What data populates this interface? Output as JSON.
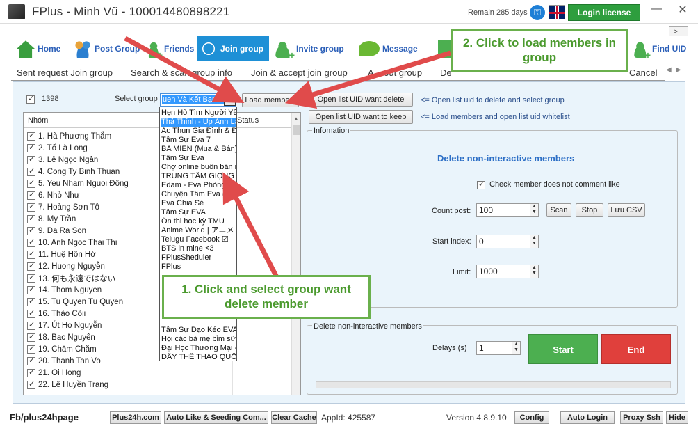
{
  "window": {
    "title": "FPlus - Minh Vũ - 100014480898221",
    "remain": "Remain 285 days",
    "login_label": "Login license",
    "min_symbol": "—",
    "close_symbol": "✕",
    "expand_label": ">..."
  },
  "nav": {
    "home": "Home",
    "post_group": "Post Group",
    "friends": "Friends",
    "join_group": "Join group",
    "invite_group": "Invite group",
    "message": "Message",
    "find_uid": "Find UID"
  },
  "subtabs": {
    "sent_request": "Sent request Join group",
    "search_scan": "Search & scan group info",
    "join_accept": "Join & accept join group",
    "a_out_group": "A... out group",
    "de": "De",
    "cancel": "Cancel",
    "prev_arrow": "◀",
    "next_arrow": "▶"
  },
  "controls": {
    "group_count": "1398",
    "select_label": "Select group",
    "selected_group": "uen Và Kết Bạn 15",
    "load_members": "Load members",
    "open_delete": "Open list UID want delete",
    "open_keep": "Open list UID want to keep",
    "hint_delete": "<= Open list uid to delete and select group",
    "hint_keep": "<= Load members and open list uid whitelist"
  },
  "list": {
    "col_group": "Nhóm",
    "col_status": "Status",
    "rows": [
      "1. Hà Phương Thắm",
      "2. Tố Là Long",
      "3. Lê Ngọc Ngân",
      "4. Cong Ty Binh Thuan",
      "5. Yeu Nham Nguoi Đông",
      "6. Nhỏ Như",
      "7. Hoàng Sơn Tô",
      "8. My Trần",
      "9. Đa Ra Son",
      "10. Anh Ngoc Thai Thi",
      "11. Huệ Hôn Hờ",
      "12. Huong Nguyễn",
      "13. 何も永遠ではない",
      "14. Thom Nguyen",
      "15. Tu Quyen Tu Quyen",
      "16. Thảo Còii",
      "17. Út Ho Nguyễn",
      "18. Bac Nguyên",
      "19. Chăm Chăm",
      "20. Thanh Tan Vo",
      "21. Oi Hong",
      "22. Lê Huyền Trang"
    ]
  },
  "dropdown": {
    "items": [
      "Hẹn Hò Tìm Người Yêu",
      "Thả Thính - Úp Ảnh Làm Quen",
      "Áo Thun Gia Đình & Đồng Phục",
      "Tâm Sự Eva 7",
      "BA MIỀN (Mua & Bán)",
      "Tâm Sự Eva",
      "Chợ online buôn bán rao vặt",
      "TRUNG TÂM GIỌNG CA",
      "Edam - Eva Phòng Thanh",
      "Chuyện Tâm Eva ( Chỉ Chị Em )",
      "Eva Chia Sẻ",
      "Tâm Sự EVA",
      "Ôn thi học kỳ TMU",
      "Anime World | アニメ",
      "Telugu Facebook ☑",
      "BTS in mine <3",
      "FPlusSheduler",
      "FPlus",
      "",
      "",
      "",
      "",
      "",
      "",
      "Tâm Sự Dạo Kéo EVA",
      "Hội các bà mẹ bỉm sữa",
      "Đại Học Thương Mại - TMU",
      "DÂY THỂ THAO QUỐC TẾ"
    ]
  },
  "info": {
    "group_title": "Infomation",
    "heading": "Delete non-interactive members",
    "check_comment": "Check member does not comment like",
    "count_post_label": "Count post:",
    "count_post_value": "100",
    "scan": "Scan",
    "stop": "Stop",
    "luu_csv": "Lưu CSV",
    "start_index_label": "Start index:",
    "start_index_value": "0",
    "limit_label": "Limit:",
    "limit_value": "1000"
  },
  "delete_group": {
    "title": "Delete non-interactive members",
    "delays_label": "Delays (s)",
    "delays_value": "1",
    "start": "Start",
    "end": "End"
  },
  "callouts": {
    "one": "1. Click and select group want delete member",
    "two": "2. Click to load members in group"
  },
  "status": {
    "fb": "Fb/plus24hpage",
    "plus24h": "Plus24h.com",
    "auto_like": "Auto Like & Seeding Com...",
    "clear_cache": "Clear Cache",
    "appid": "AppId: 425587",
    "version": "Version 4.8.9.10",
    "config": "Config",
    "auto_login": "Auto Login",
    "proxy_ssh": "Proxy Ssh",
    "hide": "Hide"
  },
  "colors": {
    "accent_blue": "#1e90d6",
    "login_green": "#2e9e3e",
    "start_green": "#4caf50",
    "end_red": "#e0403c",
    "callout_green": "#6ab04c",
    "arrow_red": "#e04b4b"
  },
  "icons": {
    "home": "home-icon",
    "post_group": "people-group-icon",
    "friends": "add-friend-icon",
    "join_group": "join-group-icon",
    "invite_group": "invite-user-icon",
    "message": "chat-bubble-icon",
    "find_uid": "find-uid-icon",
    "key": "key-icon",
    "language": "uk-flag-icon"
  }
}
